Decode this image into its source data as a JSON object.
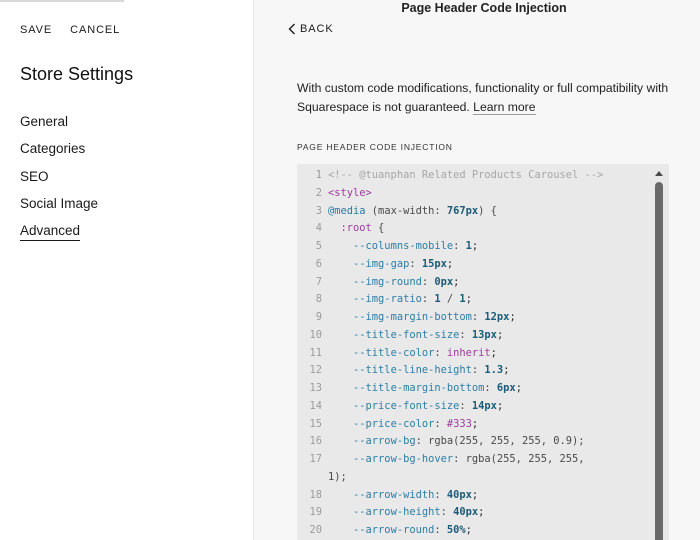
{
  "left": {
    "save": "SAVE",
    "cancel": "CANCEL",
    "title": "Store Settings",
    "nav": [
      "General",
      "Categories",
      "SEO",
      "Social Image",
      "Advanced"
    ],
    "active": "Advanced"
  },
  "main": {
    "heading": "Page Header Code Injection",
    "back": "BACK",
    "notice": "With custom code modifications, functionality or full compatibility with Squarespace is not guaranteed.",
    "learn_more": "Learn more",
    "section_label": "PAGE HEADER CODE INJECTION"
  },
  "code_lines": [
    {
      "n": "1",
      "parts": [
        [
          "cm",
          "<!-- @tuanphan Related Products Carousel -->"
        ]
      ]
    },
    {
      "n": "2",
      "parts": [
        [
          "tg",
          "<style>"
        ]
      ]
    },
    {
      "n": "3",
      "parts": [
        [
          "at",
          "@media"
        ],
        [
          "pl",
          " (max-width: "
        ],
        [
          "nu",
          "767px"
        ],
        [
          "pl",
          ") {"
        ]
      ]
    },
    {
      "n": "4",
      "parts": [
        [
          "pl",
          "  "
        ],
        [
          "tg",
          ":root"
        ],
        [
          "pl",
          " {"
        ]
      ]
    },
    {
      "n": "5",
      "parts": [
        [
          "pl",
          "    "
        ],
        [
          "pr",
          "--columns-mobile"
        ],
        [
          "pl",
          ": "
        ],
        [
          "nu",
          "1"
        ],
        [
          "sc",
          ";"
        ]
      ]
    },
    {
      "n": "6",
      "parts": [
        [
          "pl",
          "    "
        ],
        [
          "pr",
          "--img-gap"
        ],
        [
          "pl",
          ": "
        ],
        [
          "nu",
          "15px"
        ],
        [
          "sc",
          ";"
        ]
      ]
    },
    {
      "n": "7",
      "parts": [
        [
          "pl",
          "    "
        ],
        [
          "pr",
          "--img-round"
        ],
        [
          "pl",
          ": "
        ],
        [
          "nu",
          "0px"
        ],
        [
          "sc",
          ";"
        ]
      ]
    },
    {
      "n": "8",
      "parts": [
        [
          "pl",
          "    "
        ],
        [
          "pr",
          "--img-ratio"
        ],
        [
          "pl",
          ": "
        ],
        [
          "nu",
          "1"
        ],
        [
          "pl",
          " / "
        ],
        [
          "nu",
          "1"
        ],
        [
          "sc",
          ";"
        ]
      ]
    },
    {
      "n": "9",
      "parts": [
        [
          "pl",
          "    "
        ],
        [
          "pr",
          "--img-margin-bottom"
        ],
        [
          "pl",
          ": "
        ],
        [
          "nu",
          "12px"
        ],
        [
          "sc",
          ";"
        ]
      ]
    },
    {
      "n": "10",
      "parts": [
        [
          "pl",
          "    "
        ],
        [
          "pr",
          "--title-font-size"
        ],
        [
          "pl",
          ": "
        ],
        [
          "nu",
          "13px"
        ],
        [
          "sc",
          ";"
        ]
      ]
    },
    {
      "n": "11",
      "parts": [
        [
          "pl",
          "    "
        ],
        [
          "pr",
          "--title-color"
        ],
        [
          "pl",
          ": "
        ],
        [
          "kw",
          "inherit"
        ],
        [
          "sc",
          ";"
        ]
      ]
    },
    {
      "n": "12",
      "parts": [
        [
          "pl",
          "    "
        ],
        [
          "pr",
          "--title-line-height"
        ],
        [
          "pl",
          ": "
        ],
        [
          "nu",
          "1.3"
        ],
        [
          "sc",
          ";"
        ]
      ]
    },
    {
      "n": "13",
      "parts": [
        [
          "pl",
          "    "
        ],
        [
          "pr",
          "--title-margin-bottom"
        ],
        [
          "pl",
          ": "
        ],
        [
          "nu",
          "6px"
        ],
        [
          "sc",
          ";"
        ]
      ]
    },
    {
      "n": "14",
      "parts": [
        [
          "pl",
          "    "
        ],
        [
          "pr",
          "--price-font-size"
        ],
        [
          "pl",
          ": "
        ],
        [
          "nu",
          "14px"
        ],
        [
          "sc",
          ";"
        ]
      ]
    },
    {
      "n": "15",
      "parts": [
        [
          "pl",
          "    "
        ],
        [
          "pr",
          "--price-color"
        ],
        [
          "pl",
          ": "
        ],
        [
          "kw",
          "#333"
        ],
        [
          "sc",
          ";"
        ]
      ]
    },
    {
      "n": "16",
      "parts": [
        [
          "pl",
          "    "
        ],
        [
          "pr",
          "--arrow-bg"
        ],
        [
          "pl",
          ": rgba(255, 255, 255, 0.9);"
        ]
      ]
    },
    {
      "n": "17",
      "parts": [
        [
          "pl",
          "    "
        ],
        [
          "pr",
          "--arrow-bg-hover"
        ],
        [
          "pl",
          ": rgba(255, 255, 255,"
        ]
      ]
    },
    {
      "n": "",
      "cont": true,
      "parts": [
        [
          "pl",
          "1);"
        ]
      ]
    },
    {
      "n": "18",
      "parts": [
        [
          "pl",
          "    "
        ],
        [
          "pr",
          "--arrow-width"
        ],
        [
          "pl",
          ": "
        ],
        [
          "nu",
          "40px"
        ],
        [
          "sc",
          ";"
        ]
      ]
    },
    {
      "n": "19",
      "parts": [
        [
          "pl",
          "    "
        ],
        [
          "pr",
          "--arrow-height"
        ],
        [
          "pl",
          ": "
        ],
        [
          "nu",
          "40px"
        ],
        [
          "sc",
          ";"
        ]
      ]
    },
    {
      "n": "20",
      "parts": [
        [
          "pl",
          "    "
        ],
        [
          "pr",
          "--arrow-round"
        ],
        [
          "pl",
          ": "
        ],
        [
          "nu",
          "50%"
        ],
        [
          "sc",
          ";"
        ]
      ]
    }
  ]
}
